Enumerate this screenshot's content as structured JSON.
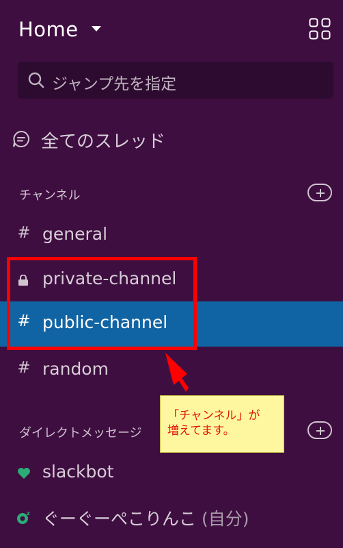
{
  "header": {
    "title": "Home",
    "caret_icon": "chevron-down-icon",
    "apps_icon": "grid-icon"
  },
  "search": {
    "placeholder": "ジャンプ先を指定",
    "icon": "search-icon"
  },
  "threads": {
    "label": "全てのスレッド",
    "icon": "threads-icon"
  },
  "channels": {
    "title": "チャンネル",
    "items": [
      {
        "glyph": "#",
        "label": "general",
        "active": false
      },
      {
        "glyph": "lock",
        "label": "private-channel",
        "active": false
      },
      {
        "glyph": "#",
        "label": "public-channel",
        "active": true
      },
      {
        "glyph": "#",
        "label": "random",
        "active": false
      }
    ]
  },
  "direct_messages": {
    "title": "ダイレクトメッセージ",
    "items": [
      {
        "icon": "heart-icon",
        "label": "slackbot"
      },
      {
        "icon": "away-status-icon",
        "label": "ぐーぐーぺこりんこ",
        "suffix": "(自分)"
      }
    ]
  },
  "annotation": {
    "text_line1": "「チャンネル」が",
    "text_line2": "増えてます。"
  },
  "colors": {
    "sidebar_bg": "#3f0e40",
    "active_bg": "#1164a3",
    "highlight": "#ff0000",
    "callout_bg": "#fff7a0",
    "callout_text": "#e0160b",
    "presence_green": "#2bac76"
  }
}
